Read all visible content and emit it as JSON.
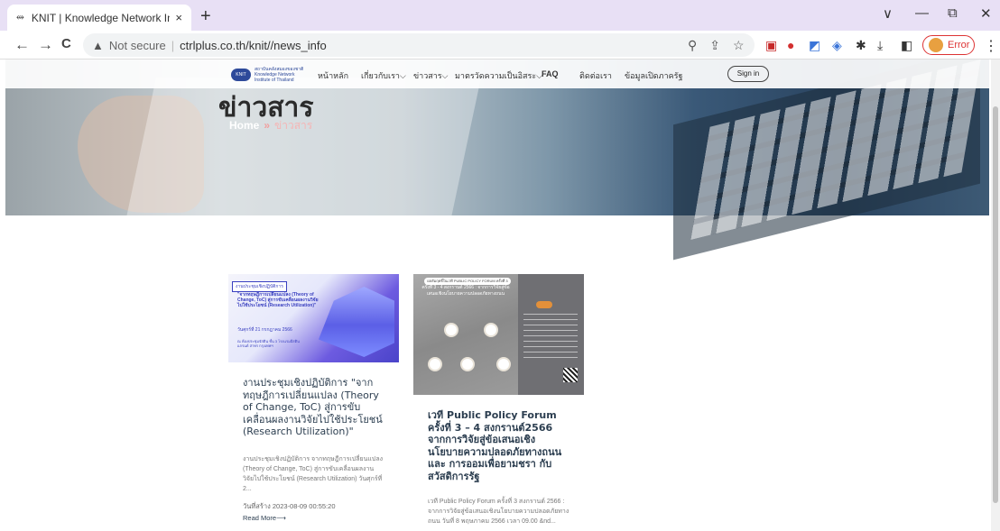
{
  "browser": {
    "tab_title": "KNIT | Knowledge Network Instit",
    "tab_favicon": "knit-favicon",
    "close_tab": "×",
    "new_tab": "+",
    "back": "←",
    "forward": "→",
    "reload": "C",
    "security_icon": "▲",
    "security_label": "Not secure",
    "url": "ctrlplus.co.th/knit//news_info",
    "error_label": "Error",
    "menu": "⋮",
    "minimize": "—",
    "restore": "⧉",
    "close_window": "✕",
    "tab_search": "∨"
  },
  "site_nav": {
    "logo_badge": "KNIT",
    "logo_text": "สถาบันคลังสมองของชาติ Knowledge Network Institute of Thailand",
    "items": [
      "หน้าหลัก",
      "เกี่ยวกับเรา",
      "ข่าวสาร",
      "มาตรวัดความเป็นอิสระ",
      "FAQ",
      "ติดต่อเรา",
      "ข้อมูลเปิดภาครัฐ"
    ],
    "dropdown_marks": [
      "",
      "⌵",
      "⌵",
      "⌵",
      "",
      "",
      ""
    ],
    "signin_label": "Sign in"
  },
  "hero": {
    "title": "ข่าวสาร",
    "breadcrumb_home": "Home",
    "breadcrumb_sep": "»",
    "breadcrumb_current": "ข่าวสาร"
  },
  "cards": [
    {
      "image_tag": "งานประชุมเชิงปฏิบัติการ",
      "image_title": "\"จากทฤษฎีการเปลี่ยนแปลง (Theory of Change, ToC) สู่การขับเคลื่อนผลงานวิจัยไปใช้ประโยชน์ (Research Utilization)\"",
      "image_date": "วันศุกร์ที่ 21 กรกฎาคม 2566",
      "image_place": "ณ ห้องประชุมจัสติน ชั้น 3 โรงแรมอีสติน แกรนด์ สาทร กรุงเทพฯ",
      "title": "งานประชุมเชิงปฏิบัติการ \"จากทฤษฎีการเปลี่ยนแปลง (Theory of Change, ToC) สู่การขับเคลื่อนผลงานวิจัยไปใช้ประโยชน์ (Research Utilization)\"",
      "excerpt": "งานประชุมเชิงปฏิบัติการ จากทฤษฎีการเปลี่ยนแปลง (Theory of Change, ToC) สู่การขับเคลื่อนผลงานวิจัยไปใช้ประโยชน์ (Research Utilization) วันศุกร์ที่ 2...",
      "date": "วันที่สร้าง 2023-08-09 00:55:20",
      "read_more": "Read More⟶"
    },
    {
      "image_pill": "ผลสัมฤทธิ์ในเวที PUBLIC POLICY FORUM ครั้งที่ 3",
      "image_title": "ครั้งที่ 3 - 4 สงกรานต์ 2566 : จากการวิจัยสู่ข้อเสนอเชิงนโยบายความปลอดภัยทางถนน",
      "title": "เวที Public Policy Forum ครั้งที่ 3 – 4 สงกรานต์2566 จากการวิจัยสู่ข้อเสนอเชิงนโยบายความปลอดภัยทางถนน และ การออมเพื่อยามชรา กับสวัสดิการรัฐ",
      "excerpt": "เวที Public Policy Forum ครั้งที่ 3 สงกรานต์ 2566 : จากการวิจัยสู่ข้อเสนอเชิงนโยบายความปลอดภัยทางถนน วันที่ 8 พฤษภาคม 2566 เวลา 09.00 &nd..."
    }
  ]
}
